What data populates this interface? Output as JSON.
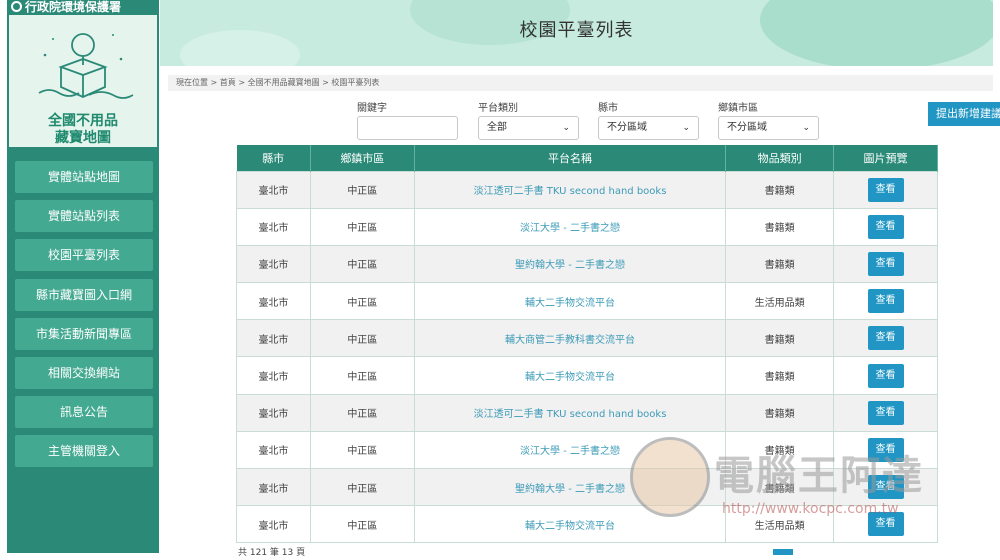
{
  "sidebar": {
    "top_text": "行政院環境保護署",
    "logo_title_line1": "全國不用品",
    "logo_title_line2": "藏寶地圖",
    "items": [
      {
        "label": "實體站點地圖"
      },
      {
        "label": "實體站點列表"
      },
      {
        "label": "校園平臺列表"
      },
      {
        "label": "縣市藏寶圖入口網"
      },
      {
        "label": "市集活動新聞專區"
      },
      {
        "label": "相關交換網站"
      },
      {
        "label": "訊息公告"
      },
      {
        "label": "主管機關登入"
      }
    ]
  },
  "header": {
    "title": "校園平臺列表"
  },
  "breadcrumb": "現在位置 > 首頁 > 全國不用品藏寶地圖 > 校園平臺列表",
  "filters": {
    "keyword_label": "關鍵字",
    "keyword_value": "",
    "type_label": "平台類別",
    "type_value": "全部",
    "city_label": "縣市",
    "city_value": "不分區域",
    "district_label": "鄉鎮市區",
    "district_value": "不分區域"
  },
  "propose_button": "提出新增建議",
  "table": {
    "headers": [
      "縣市",
      "鄉鎮市區",
      "平台名稱",
      "物品類別",
      "圖片預覽"
    ],
    "view_label": "查看",
    "rows": [
      {
        "city": "臺北市",
        "district": "中正區",
        "name": "淡江透可二手書 TKU second hand books",
        "category": "書籍類"
      },
      {
        "city": "臺北市",
        "district": "中正區",
        "name": "淡江大學 - 二手書之戀",
        "category": "書籍類"
      },
      {
        "city": "臺北市",
        "district": "中正區",
        "name": "聖約翰大學 - 二手書之戀",
        "category": "書籍類"
      },
      {
        "city": "臺北市",
        "district": "中正區",
        "name": "輔大二手物交流平台",
        "category": "生活用品類"
      },
      {
        "city": "臺北市",
        "district": "中正區",
        "name": "輔大商管二手教科書交流平台",
        "category": "書籍類"
      },
      {
        "city": "臺北市",
        "district": "中正區",
        "name": "輔大二手物交流平台",
        "category": "書籍類"
      },
      {
        "city": "臺北市",
        "district": "中正區",
        "name": "淡江透可二手書 TKU second hand books",
        "category": "書籍類"
      },
      {
        "city": "臺北市",
        "district": "中正區",
        "name": "淡江大學 - 二手書之戀",
        "category": "書籍類"
      },
      {
        "city": "臺北市",
        "district": "中正區",
        "name": "聖約翰大學 - 二手書之戀",
        "category": "書籍類"
      },
      {
        "city": "臺北市",
        "district": "中正區",
        "name": "輔大二手物交流平台",
        "category": "生活用品類"
      }
    ]
  },
  "pager_text": "共 121 筆 13 頁",
  "watermark": {
    "brand": "電腦王阿達",
    "url": "http://www.kocpc.com.tw"
  },
  "colors": {
    "primary": "#2a8a77",
    "button": "#2196c4",
    "header_bg": "#c7ebdf",
    "link": "#3d9bb7"
  }
}
